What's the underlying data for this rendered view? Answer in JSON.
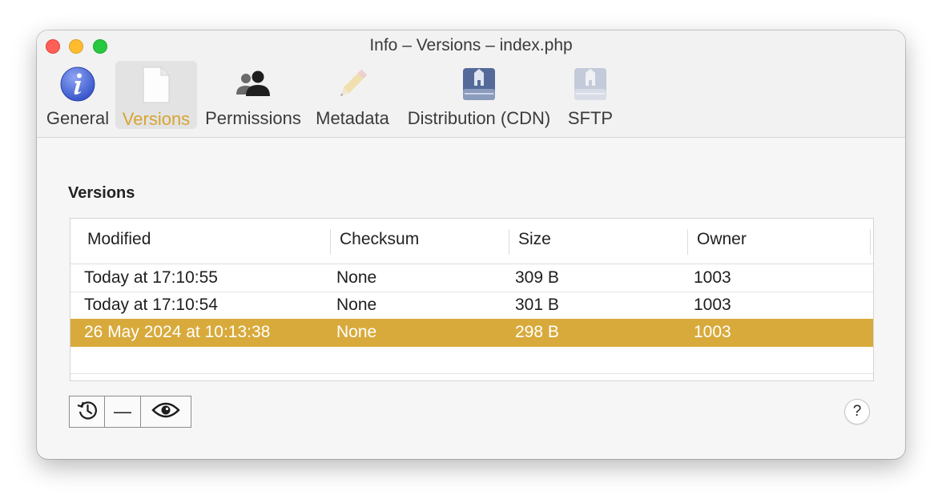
{
  "window": {
    "title": "Info – Versions – index.php"
  },
  "toolbar": {
    "items": [
      {
        "label": "General",
        "icon": "info-icon"
      },
      {
        "label": "Versions",
        "icon": "document-icon",
        "selected": true
      },
      {
        "label": "Permissions",
        "icon": "users-icon"
      },
      {
        "label": "Metadata",
        "icon": "pencil-icon",
        "disabled": true
      },
      {
        "label": "Distribution (CDN)",
        "icon": "drive-icon"
      },
      {
        "label": "SFTP",
        "icon": "drive-icon",
        "disabled": true
      }
    ]
  },
  "versions": {
    "section_title": "Versions",
    "columns": [
      "Modified",
      "Checksum",
      "Size",
      "Owner"
    ],
    "rows": [
      {
        "modified": "Today at 17:10:55",
        "checksum": "None",
        "size": "309 B",
        "owner": "1003",
        "selected": false
      },
      {
        "modified": "Today at 17:10:54",
        "checksum": "None",
        "size": "301 B",
        "owner": "1003",
        "selected": false
      },
      {
        "modified": "26 May 2024 at 10:13:38",
        "checksum": "None",
        "size": "298 B",
        "owner": "1003",
        "selected": true
      }
    ]
  },
  "buttons": {
    "revert_icon": "revert-history-icon",
    "delete_label": "—",
    "quicklook_icon": "eye-icon",
    "help_label": "?"
  },
  "colors": {
    "accent": "#d8aa3b",
    "close": "#fe5f57",
    "minimize": "#febc2e",
    "maximize": "#28c840"
  }
}
